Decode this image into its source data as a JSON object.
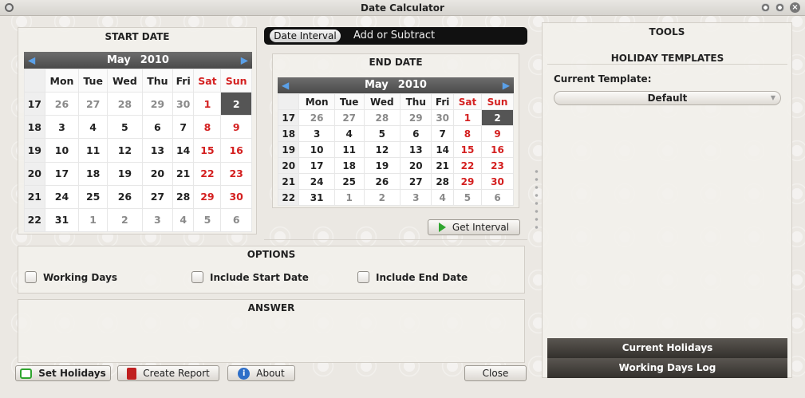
{
  "window": {
    "title": "Date Calculator"
  },
  "modes": {
    "active": "Date Interval",
    "inactive": "Add or Subtract"
  },
  "start_calendar": {
    "title": "START DATE",
    "month": "May",
    "year": "2010",
    "weekdays": [
      "Mon",
      "Tue",
      "Wed",
      "Thu",
      "Fri",
      "Sat",
      "Sun"
    ],
    "weeks": [
      {
        "wk": "17",
        "days": [
          "26",
          "27",
          "28",
          "29",
          "30",
          "1",
          "2"
        ]
      },
      {
        "wk": "18",
        "days": [
          "3",
          "4",
          "5",
          "6",
          "7",
          "8",
          "9"
        ]
      },
      {
        "wk": "19",
        "days": [
          "10",
          "11",
          "12",
          "13",
          "14",
          "15",
          "16"
        ]
      },
      {
        "wk": "20",
        "days": [
          "17",
          "18",
          "19",
          "20",
          "21",
          "22",
          "23"
        ]
      },
      {
        "wk": "21",
        "days": [
          "24",
          "25",
          "26",
          "27",
          "28",
          "29",
          "30"
        ]
      },
      {
        "wk": "22",
        "days": [
          "31",
          "1",
          "2",
          "3",
          "4",
          "5",
          "6"
        ]
      }
    ],
    "selected": "2"
  },
  "end_calendar": {
    "title": "END DATE",
    "month": "May",
    "year": "2010",
    "weekdays": [
      "Mon",
      "Tue",
      "Wed",
      "Thu",
      "Fri",
      "Sat",
      "Sun"
    ],
    "weeks": [
      {
        "wk": "17",
        "days": [
          "26",
          "27",
          "28",
          "29",
          "30",
          "1",
          "2"
        ]
      },
      {
        "wk": "18",
        "days": [
          "3",
          "4",
          "5",
          "6",
          "7",
          "8",
          "9"
        ]
      },
      {
        "wk": "19",
        "days": [
          "10",
          "11",
          "12",
          "13",
          "14",
          "15",
          "16"
        ]
      },
      {
        "wk": "20",
        "days": [
          "17",
          "18",
          "19",
          "20",
          "21",
          "22",
          "23"
        ]
      },
      {
        "wk": "21",
        "days": [
          "24",
          "25",
          "26",
          "27",
          "28",
          "29",
          "30"
        ]
      },
      {
        "wk": "22",
        "days": [
          "31",
          "1",
          "2",
          "3",
          "4",
          "5",
          "6"
        ]
      }
    ],
    "selected": "2"
  },
  "get_interval": {
    "label": "Get Interval"
  },
  "options": {
    "title": "OPTIONS",
    "items": [
      "Working Days",
      "Include Start Date",
      "Include End Date"
    ]
  },
  "answer": {
    "title": "ANSWER"
  },
  "tools": {
    "title": "TOOLS",
    "holiday_title": "HOLIDAY TEMPLATES",
    "current_template_label": "Current Template:",
    "template_value": "Default",
    "current_holidays": "Current Holidays",
    "working_days_log": "Working Days Log"
  },
  "footer": {
    "set_holidays": "Set Holidays",
    "create_report": "Create Report",
    "about": "About",
    "close": "Close"
  },
  "colors": {
    "accent_green": "#2fa52f",
    "weekend_red": "#d42020",
    "arrow_blue": "#5aa0e8"
  }
}
